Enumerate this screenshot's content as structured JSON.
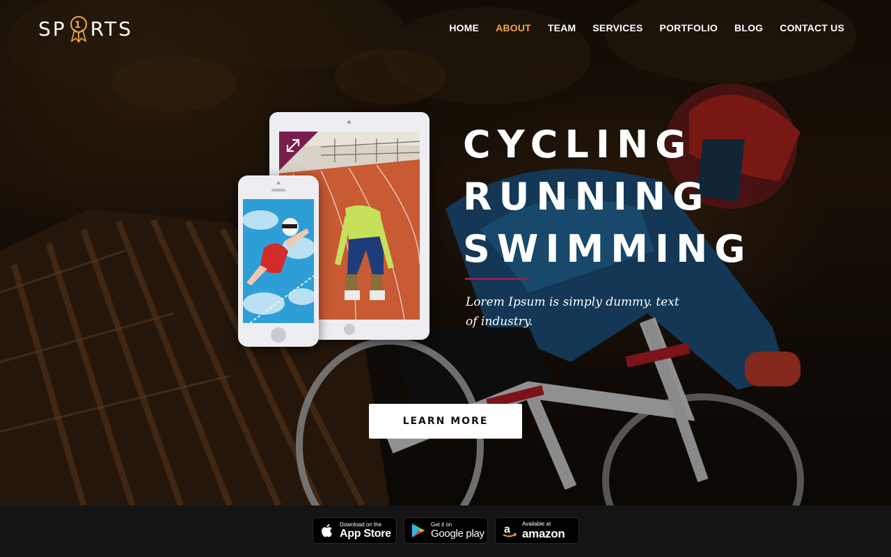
{
  "brand": {
    "logo_left": "SP",
    "logo_right": "RTS",
    "medal_number": "1",
    "accent": "#f2a93b"
  },
  "nav": {
    "items": [
      {
        "label": "HOME",
        "active": false
      },
      {
        "label": "ABOUT",
        "active": true
      },
      {
        "label": "TEAM",
        "active": false
      },
      {
        "label": "SERVICES",
        "active": false
      },
      {
        "label": "PORTFOLIO",
        "active": false
      },
      {
        "label": "BLOG",
        "active": false
      },
      {
        "label": "CONTACT US",
        "active": false
      }
    ]
  },
  "hero": {
    "headline": [
      "CYCLING",
      "RUNNING",
      "SWIMMING"
    ],
    "tagline": "Lorem Ipsum is simply dummy. text of industry.",
    "cta_label": "LEARN MORE",
    "divider_color": "#8a2358",
    "devices": {
      "tablet_image": "runner-on-track",
      "phone_image": "swimmer-in-pool",
      "expand_icon": "expand-icon"
    }
  },
  "footer": {
    "badges": [
      {
        "icon": "apple-icon",
        "small": "Download on the",
        "big": "App Store"
      },
      {
        "icon": "google-play-icon",
        "small": "Get it on",
        "big": "Google play"
      },
      {
        "icon": "amazon-icon",
        "small": "Available at",
        "big": "amazon"
      }
    ]
  }
}
